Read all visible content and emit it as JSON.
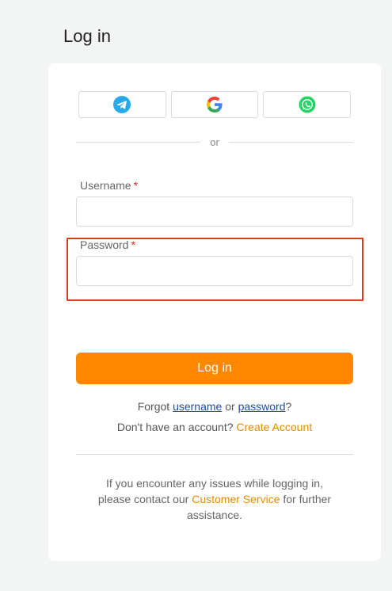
{
  "page": {
    "title": "Log in"
  },
  "social": {
    "buttons": [
      {
        "icon": "telegram-icon",
        "color": "#29a9eb"
      },
      {
        "icon": "google-icon",
        "color": "#4285f4"
      },
      {
        "icon": "whatsapp-icon",
        "color": "#25d366"
      }
    ],
    "divider_text": "or"
  },
  "form": {
    "username": {
      "label": "Username",
      "required_mark": "*",
      "value": "",
      "placeholder": ""
    },
    "password": {
      "label": "Password",
      "required_mark": "*",
      "value": "",
      "placeholder": ""
    },
    "submit_label": "Log in"
  },
  "links": {
    "forgot_prefix": "Forgot",
    "forgot_username": "username",
    "forgot_or": "or",
    "forgot_password": "password",
    "forgot_suffix": "?",
    "signup_prefix": "Don't have an account?",
    "signup_link": "Create Account"
  },
  "help": {
    "line_prefix": "If you encounter any issues while logging in, please contact our",
    "link": "Customer Service",
    "line_suffix": "for further assistance."
  },
  "colors": {
    "accent": "#ff8800",
    "link_blue": "#1a4fa0",
    "required_red": "#e0261b",
    "highlight_red": "#e0391b"
  }
}
